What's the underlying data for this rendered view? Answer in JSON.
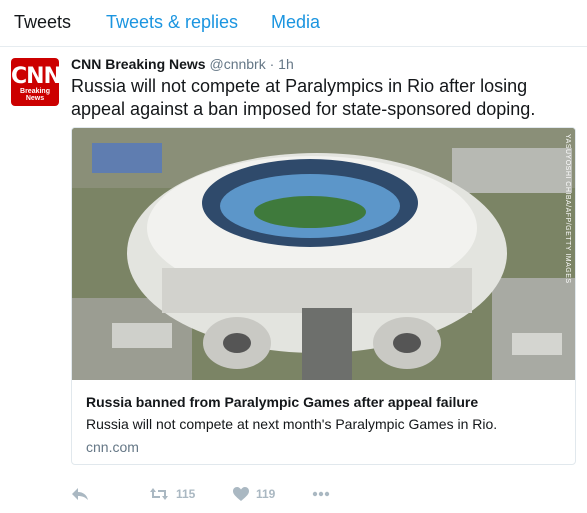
{
  "tabs": [
    "Tweets",
    "Tweets & replies",
    "Media"
  ],
  "tweet": {
    "avatar_text": "CNN",
    "avatar_subtext": "Breaking News",
    "name": "CNN Breaking News",
    "handle": "@cnnbrk",
    "separator": "·",
    "time": "1h",
    "text": "Russia will not compete at Paralympics in Rio after losing appeal against a ban imposed for state-sponsored doping."
  },
  "card": {
    "image_credit": "YASUYOSHI CHIBA/AFP/GETTY IMAGES",
    "title": "Russia banned from Paralympic Games after appeal failure",
    "description": "Russia will not compete at next month's Paralympic Games in Rio.",
    "domain": "cnn.com"
  },
  "actions": {
    "retweet_count": "115",
    "like_count": "119"
  },
  "colors": {
    "accent": "#1b95e0",
    "brand": "#cc0000",
    "muted": "#657786",
    "icon": "#aab8c2"
  }
}
